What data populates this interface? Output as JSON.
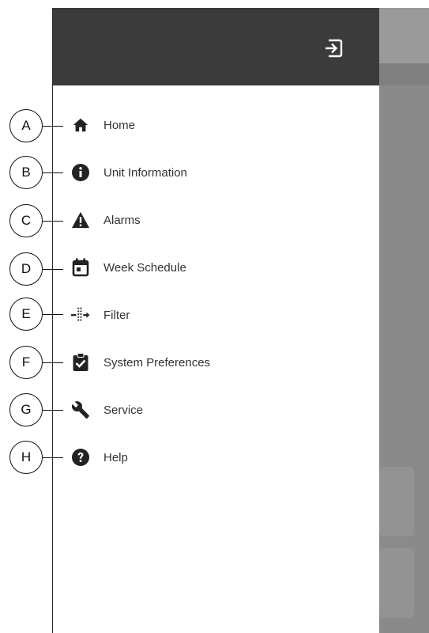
{
  "drawer": {
    "exit_icon": "logout-icon",
    "items": [
      {
        "label": "Home",
        "icon": "home-icon",
        "callout": "A"
      },
      {
        "label": "Unit Information",
        "icon": "info-icon",
        "callout": "B"
      },
      {
        "label": "Alarms",
        "icon": "warning-icon",
        "callout": "C"
      },
      {
        "label": "Week Schedule",
        "icon": "calendar-icon",
        "callout": "D"
      },
      {
        "label": "Filter",
        "icon": "filter-icon",
        "callout": "E"
      },
      {
        "label": "System Preferences",
        "icon": "clipboard-check-icon",
        "callout": "F"
      },
      {
        "label": "Service",
        "icon": "wrench-icon",
        "callout": "G"
      },
      {
        "label": "Help",
        "icon": "help-icon",
        "callout": "H"
      }
    ]
  },
  "colors": {
    "header_bg": "#3b3b3b",
    "icon": "#222222",
    "text": "#333333",
    "overlay": "#8a8a8a"
  }
}
